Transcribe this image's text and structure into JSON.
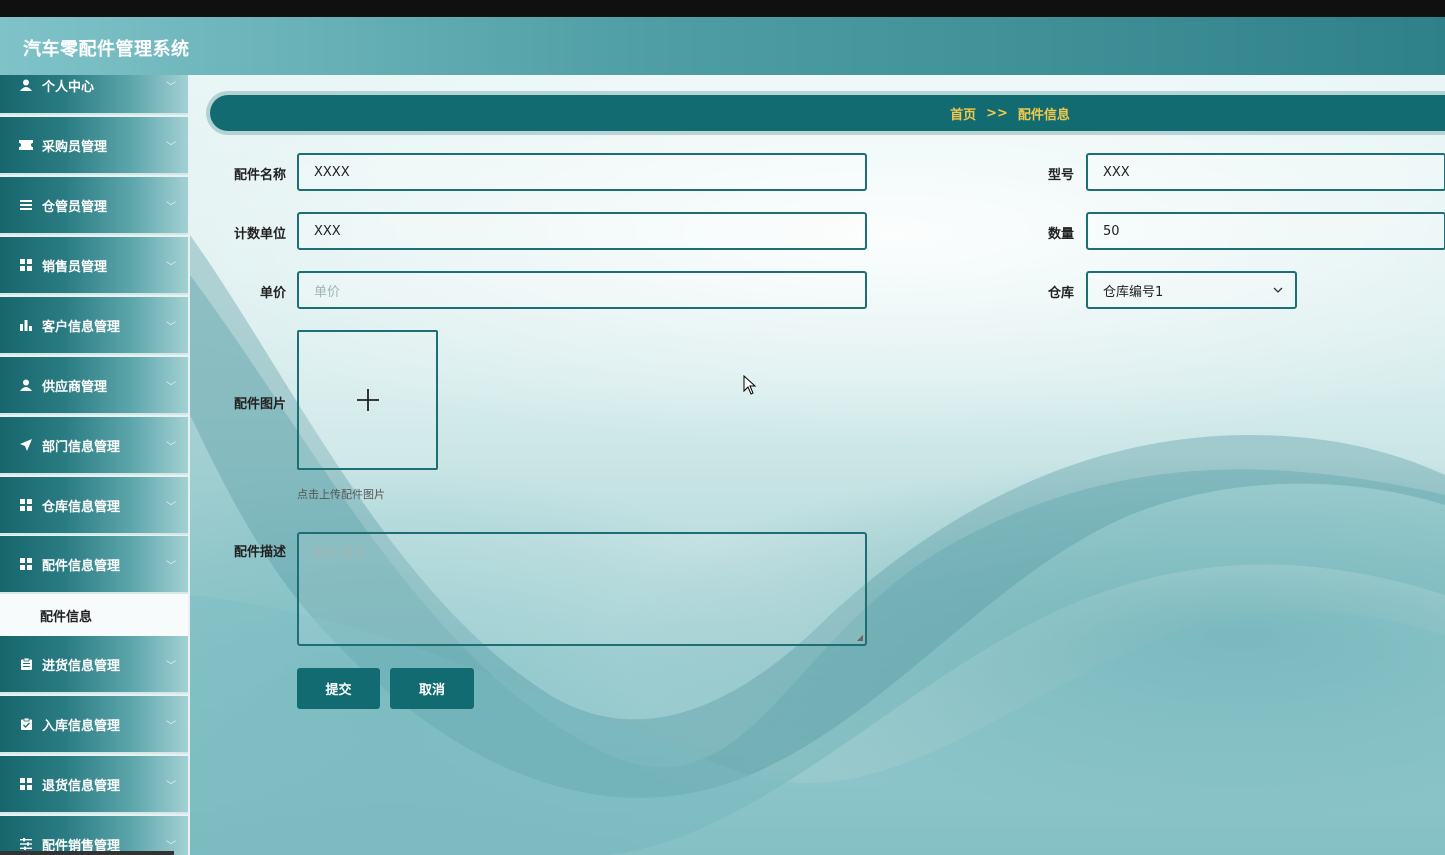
{
  "app": {
    "title": "汽车零配件管理系统"
  },
  "sidebar": {
    "items": [
      {
        "label": "个人中心",
        "icon": "user-icon"
      },
      {
        "label": "采购员管理",
        "icon": "ticket-icon"
      },
      {
        "label": "仓管员管理",
        "icon": "list-icon"
      },
      {
        "label": "销售员管理",
        "icon": "grid-icon"
      },
      {
        "label": "客户信息管理",
        "icon": "bar-chart-icon"
      },
      {
        "label": "供应商管理",
        "icon": "user-icon"
      },
      {
        "label": "部门信息管理",
        "icon": "paper-plane-icon"
      },
      {
        "label": "仓库信息管理",
        "icon": "grid-icon"
      },
      {
        "label": "配件信息管理",
        "icon": "grid-icon"
      },
      {
        "label": "进货信息管理",
        "icon": "clipboard-icon"
      },
      {
        "label": "入库信息管理",
        "icon": "clipboard-check-icon"
      },
      {
        "label": "退货信息管理",
        "icon": "grid-icon"
      },
      {
        "label": "配件销售管理",
        "icon": "sliders-icon"
      }
    ],
    "active_sub": "配件信息"
  },
  "breadcrumb": {
    "home": "首页",
    "sep": ">>",
    "current": "配件信息"
  },
  "form": {
    "name": {
      "label": "配件名称",
      "value": "XXXX"
    },
    "model": {
      "label": "型号",
      "value": "XXX"
    },
    "unit": {
      "label": "计数单位",
      "value": "XXX"
    },
    "quantity": {
      "label": "数量",
      "value": "50"
    },
    "price": {
      "label": "单价",
      "placeholder": "单价"
    },
    "warehouse": {
      "label": "仓库",
      "value": "仓库编号1"
    },
    "image": {
      "label": "配件图片",
      "tip": "点击上传配件图片"
    },
    "desc": {
      "label": "配件描述",
      "placeholder": "配件描述"
    },
    "submit": "提交",
    "cancel": "取消"
  },
  "colors": {
    "primary": "#116b70",
    "accent": "#f2c94c",
    "border": "#1e6f74"
  }
}
